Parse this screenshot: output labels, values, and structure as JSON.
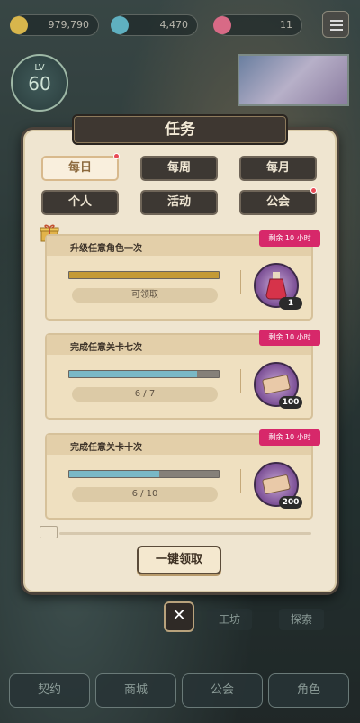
{
  "resources": {
    "gold": "979,790",
    "gems": "4,470",
    "hearts": "11"
  },
  "level": {
    "prefix": "LV",
    "value": "60"
  },
  "dialog": {
    "title": "任务"
  },
  "tabs": [
    {
      "label": "每日",
      "active": true,
      "dot": true
    },
    {
      "label": "每周",
      "active": false,
      "dot": false
    },
    {
      "label": "每月",
      "active": false,
      "dot": false
    },
    {
      "label": "个人",
      "active": false,
      "dot": false
    },
    {
      "label": "活动",
      "active": false,
      "dot": false
    },
    {
      "label": "公会",
      "active": false,
      "dot": true
    }
  ],
  "tasks": [
    {
      "title": "升级任意角色一次",
      "progress_text": "可领取",
      "progress": 1.0,
      "bar_color": "#c49a36",
      "reward_icon": "potion-icon",
      "reward_qty": "1",
      "timer": "剩余 10 小时"
    },
    {
      "title": "完成任意关卡七次",
      "progress_text": "6 / 7",
      "progress": 0.857,
      "bar_color": "#79b8c6",
      "reward_icon": "ticket-icon",
      "reward_qty": "100",
      "timer": "剩余 10 小时"
    },
    {
      "title": "完成任意关卡十次",
      "progress_text": "6 / 10",
      "progress": 0.6,
      "bar_color": "#79b8c6",
      "reward_icon": "ticket-icon",
      "reward_qty": "200",
      "timer": "剩余 10 小时"
    }
  ],
  "claim_all_label": "一键领取",
  "close_symbol": "✕",
  "mid_nav": {
    "left": "工坊",
    "right": "探索"
  },
  "bottom_nav": [
    "契约",
    "商城",
    "公会",
    "角色"
  ]
}
